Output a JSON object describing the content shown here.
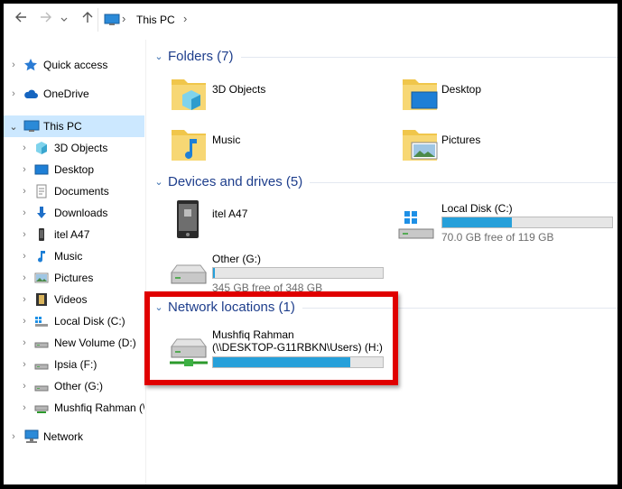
{
  "nav": {
    "back_icon": "back-arrow-icon",
    "forward_icon": "forward-arrow-icon",
    "dropdown_icon": "chevron-down-icon",
    "up_icon": "up-arrow-icon"
  },
  "address": {
    "location": "This PC"
  },
  "sidebar": {
    "items": [
      {
        "label": "Quick access"
      },
      {
        "label": "OneDrive"
      },
      {
        "label": "This PC"
      },
      {
        "label": "3D Objects"
      },
      {
        "label": "Desktop"
      },
      {
        "label": "Documents"
      },
      {
        "label": "Downloads"
      },
      {
        "label": "itel A47"
      },
      {
        "label": "Music"
      },
      {
        "label": "Pictures"
      },
      {
        "label": "Videos"
      },
      {
        "label": "Local Disk (C:)"
      },
      {
        "label": "New Volume (D:)"
      },
      {
        "label": "Ipsia (F:)"
      },
      {
        "label": "Other (G:)"
      },
      {
        "label": "Mushfiq Rahman (\\"
      },
      {
        "label": "Network"
      }
    ]
  },
  "groups": {
    "folders": {
      "title": "Folders (7)"
    },
    "devices": {
      "title": "Devices and drives (5)"
    },
    "network": {
      "title": "Network locations (1)"
    }
  },
  "folders": [
    {
      "name": "3D Objects"
    },
    {
      "name": "Desktop"
    },
    {
      "name": "Music"
    },
    {
      "name": "Pictures"
    }
  ],
  "devices": [
    {
      "name": "itel A47"
    },
    {
      "name": "Local Disk (C:)",
      "free": "70.0 GB free of 119 GB",
      "used_fraction": 0.41
    },
    {
      "name": "Other (G:)",
      "free": "345 GB free of 348 GB",
      "used_fraction": 0.01
    }
  ],
  "network_locations": [
    {
      "name": "Mushfiq Rahman",
      "path": "(\\\\DESKTOP-G11RBKN\\Users) (H:)",
      "used_fraction": 0.81
    }
  ],
  "colors": {
    "bar_fill": "#26a0da",
    "highlight": "#e00000",
    "selected": "#cce8ff"
  }
}
